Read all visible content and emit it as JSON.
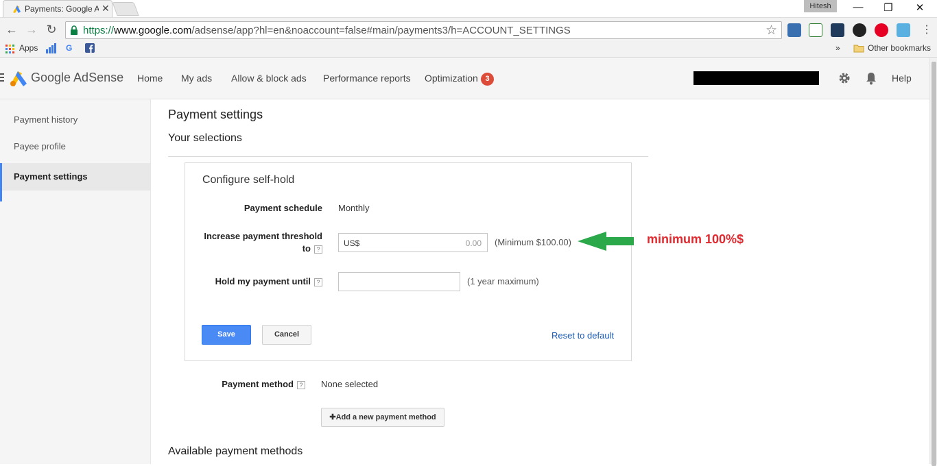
{
  "browser": {
    "tab_title": "Payments: Google A",
    "profile_name": "Hitesh",
    "url": {
      "scheme": "https://",
      "host": "www.google.com",
      "path": "/adsense/app?hl=en&noaccount=false#main/payments3/h=ACCOUNT_SETTINGS"
    },
    "bookmarks": {
      "apps_label": "Apps",
      "overflow_label": "»",
      "other_label": "Other bookmarks"
    }
  },
  "header": {
    "brand": "Google AdSense",
    "nav": [
      "Home",
      "My ads",
      "Allow & block ads",
      "Performance reports",
      "Optimization"
    ],
    "optimization_badge": "3",
    "help_label": "Help"
  },
  "sidebar": {
    "items": [
      {
        "label": "Payment history"
      },
      {
        "label": "Payee profile"
      },
      {
        "label": "Payment settings",
        "active": true
      }
    ]
  },
  "main": {
    "title": "Payment settings",
    "section_title": "Your selections",
    "card": {
      "title": "Configure self-hold",
      "schedule_label": "Payment schedule",
      "schedule_value": "Monthly",
      "threshold_label_1": "Increase payment threshold",
      "threshold_label_2": "to",
      "threshold_prefix": "US$",
      "threshold_value": "0.00",
      "threshold_hint": "(Minimum $100.00)",
      "hold_label": "Hold my payment until",
      "hold_value": "",
      "hold_hint": "(1 year maximum)",
      "help_mark": "?",
      "save_label": "Save",
      "cancel_label": "Cancel",
      "reset_label": "Reset to default"
    },
    "payment_method_label": "Payment method",
    "payment_method_value": "None selected",
    "add_method_label": "Add a new payment method",
    "available_title": "Available payment methods"
  },
  "annotation": {
    "text": "minimum 100%$",
    "color": "#e0282e",
    "arrow_color": "#2aa84a"
  }
}
